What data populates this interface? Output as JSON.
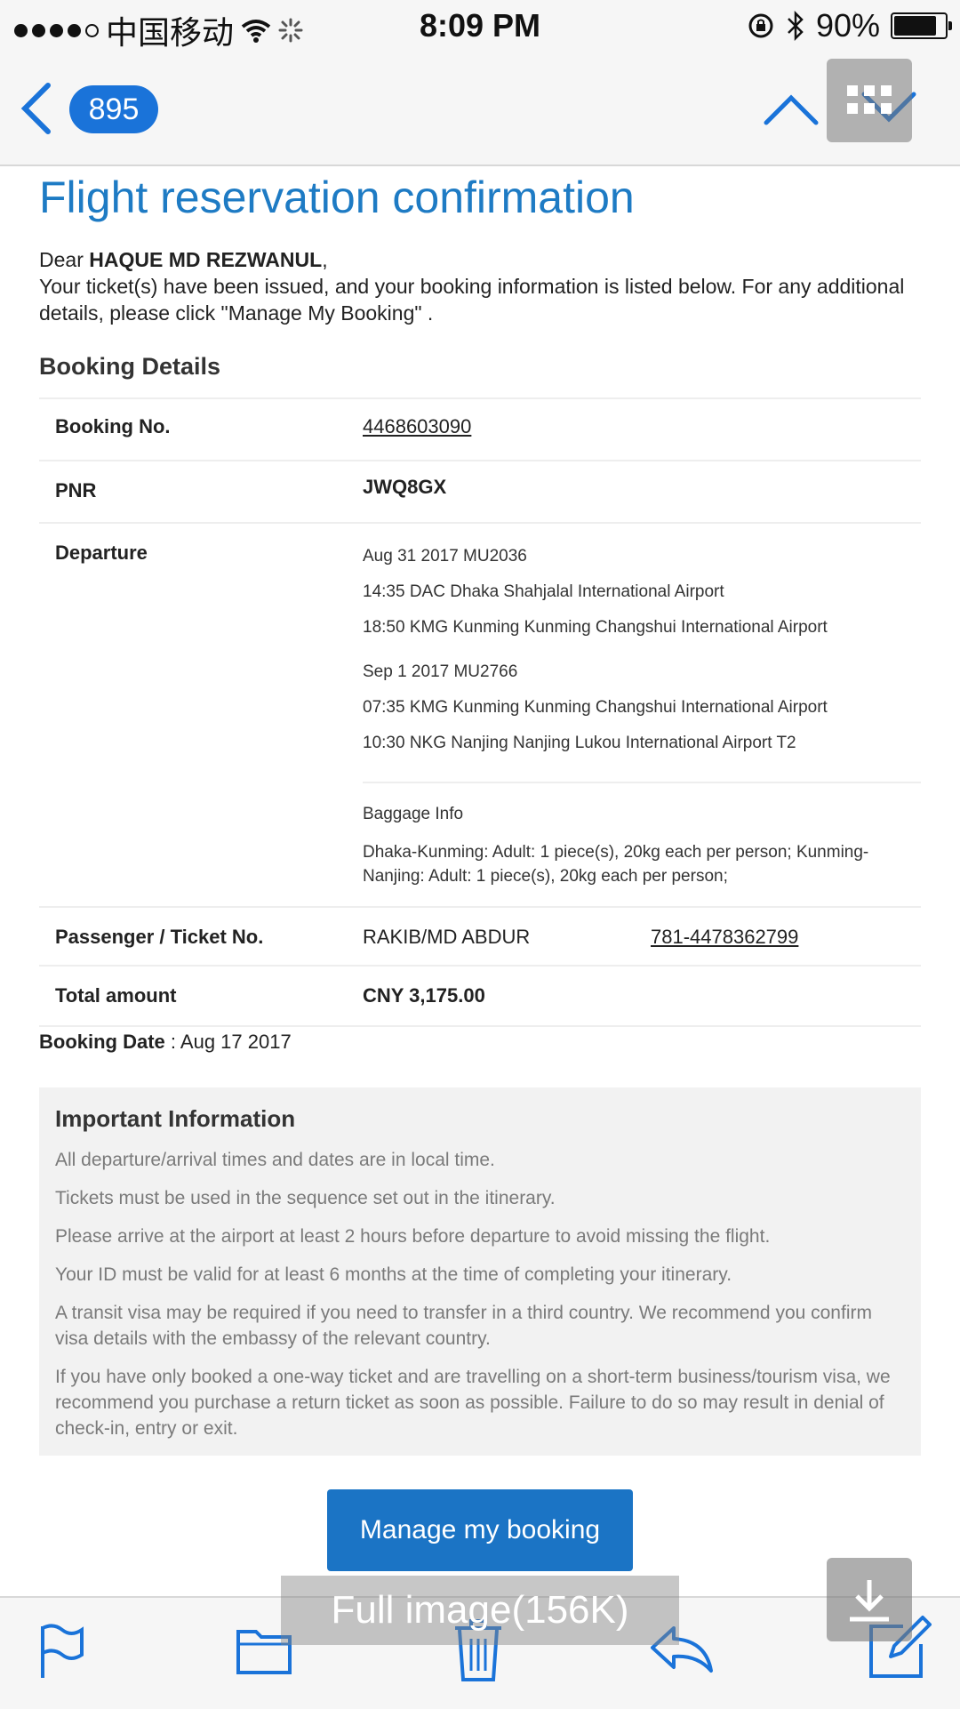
{
  "status_bar": {
    "carrier": "中国移动",
    "time": "8:09 PM",
    "battery_text": "90%",
    "battery_level": 0.9
  },
  "nav": {
    "back_count": "895"
  },
  "email": {
    "title": "Flight reservation confirmation",
    "greeting_prefix": "Dear ",
    "recipient": "HAQUE MD REZWANUL",
    "greeting_suffix": ",",
    "intro": "Your ticket(s) have been issued, and your booking information is listed below. For any additional details, please click \"Manage My Booking\" .",
    "section_title": "Booking Details",
    "booking_no_label": "Booking No.",
    "booking_no": "4468603090",
    "pnr_label": "PNR",
    "pnr": "JWQ8GX",
    "departure_label": "Departure",
    "segments": [
      "Aug 31 2017 MU2036",
      "14:35 DAC Dhaka Shahjalal International Airport",
      "18:50 KMG Kunming Kunming Changshui International Airport",
      "Sep 1 2017 MU2766",
      "07:35 KMG Kunming Kunming Changshui International Airport",
      "10:30 NKG Nanjing Nanjing Lukou International Airport T2"
    ],
    "baggage_title": "Baggage Info",
    "baggage_text": "Dhaka-Kunming: Adult: 1 piece(s), 20kg each per person; Kunming-Nanjing: Adult: 1 piece(s), 20kg each per person;",
    "passenger_label": "Passenger / Ticket No.",
    "passenger_name": "RAKIB/MD ABDUR",
    "ticket_no": "781-4478362799",
    "total_label": "Total amount",
    "total": "CNY 3,175.00",
    "booking_date_label": "Booking Date",
    "booking_date_sep": " : ",
    "booking_date": "Aug 17 2017",
    "important_title": "Important Information",
    "important_items": [
      "All departure/arrival times and dates are in local time.",
      "Tickets must be used in the sequence set out in the itinerary.",
      "Please arrive at the airport at least 2 hours before departure to avoid missing the flight.",
      "Your ID must be valid for at least 6 months at the time of completing your itinerary.",
      "A transit visa may be required if you need to transfer in a third country. We recommend you confirm visa details with the embassy of the relevant country.",
      "If you have only booked a one-way ticket and are travelling on a short-term business/tourism visa, we recommend you purchase a return ticket as soon as possible. Failure to do so may result in denial of check-in, entry or exit."
    ],
    "manage_button": "Manage my booking"
  },
  "overlay": {
    "full_image": "Full image(156K)"
  },
  "colors": {
    "accent": "#1e7bc4",
    "button": "#1b74c5",
    "link": "#2a7fd0"
  }
}
